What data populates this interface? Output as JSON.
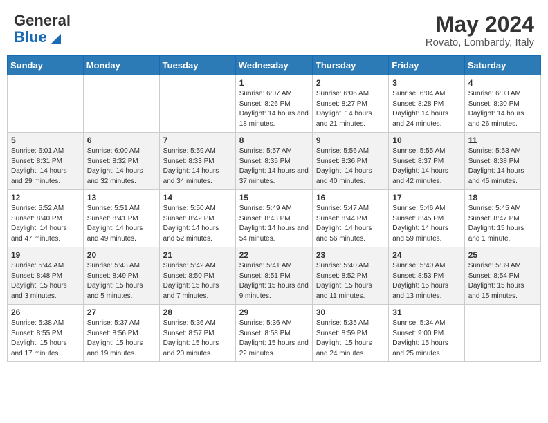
{
  "header": {
    "logo_general": "General",
    "logo_blue": "Blue",
    "month_year": "May 2024",
    "location": "Rovato, Lombardy, Italy"
  },
  "days_of_week": [
    "Sunday",
    "Monday",
    "Tuesday",
    "Wednesday",
    "Thursday",
    "Friday",
    "Saturday"
  ],
  "weeks": [
    {
      "days": [
        {
          "number": "",
          "content": ""
        },
        {
          "number": "",
          "content": ""
        },
        {
          "number": "",
          "content": ""
        },
        {
          "number": "1",
          "content": "Sunrise: 6:07 AM\nSunset: 8:26 PM\nDaylight: 14 hours and 18 minutes."
        },
        {
          "number": "2",
          "content": "Sunrise: 6:06 AM\nSunset: 8:27 PM\nDaylight: 14 hours and 21 minutes."
        },
        {
          "number": "3",
          "content": "Sunrise: 6:04 AM\nSunset: 8:28 PM\nDaylight: 14 hours and 24 minutes."
        },
        {
          "number": "4",
          "content": "Sunrise: 6:03 AM\nSunset: 8:30 PM\nDaylight: 14 hours and 26 minutes."
        }
      ]
    },
    {
      "days": [
        {
          "number": "5",
          "content": "Sunrise: 6:01 AM\nSunset: 8:31 PM\nDaylight: 14 hours and 29 minutes."
        },
        {
          "number": "6",
          "content": "Sunrise: 6:00 AM\nSunset: 8:32 PM\nDaylight: 14 hours and 32 minutes."
        },
        {
          "number": "7",
          "content": "Sunrise: 5:59 AM\nSunset: 8:33 PM\nDaylight: 14 hours and 34 minutes."
        },
        {
          "number": "8",
          "content": "Sunrise: 5:57 AM\nSunset: 8:35 PM\nDaylight: 14 hours and 37 minutes."
        },
        {
          "number": "9",
          "content": "Sunrise: 5:56 AM\nSunset: 8:36 PM\nDaylight: 14 hours and 40 minutes."
        },
        {
          "number": "10",
          "content": "Sunrise: 5:55 AM\nSunset: 8:37 PM\nDaylight: 14 hours and 42 minutes."
        },
        {
          "number": "11",
          "content": "Sunrise: 5:53 AM\nSunset: 8:38 PM\nDaylight: 14 hours and 45 minutes."
        }
      ]
    },
    {
      "days": [
        {
          "number": "12",
          "content": "Sunrise: 5:52 AM\nSunset: 8:40 PM\nDaylight: 14 hours and 47 minutes."
        },
        {
          "number": "13",
          "content": "Sunrise: 5:51 AM\nSunset: 8:41 PM\nDaylight: 14 hours and 49 minutes."
        },
        {
          "number": "14",
          "content": "Sunrise: 5:50 AM\nSunset: 8:42 PM\nDaylight: 14 hours and 52 minutes."
        },
        {
          "number": "15",
          "content": "Sunrise: 5:49 AM\nSunset: 8:43 PM\nDaylight: 14 hours and 54 minutes."
        },
        {
          "number": "16",
          "content": "Sunrise: 5:47 AM\nSunset: 8:44 PM\nDaylight: 14 hours and 56 minutes."
        },
        {
          "number": "17",
          "content": "Sunrise: 5:46 AM\nSunset: 8:45 PM\nDaylight: 14 hours and 59 minutes."
        },
        {
          "number": "18",
          "content": "Sunrise: 5:45 AM\nSunset: 8:47 PM\nDaylight: 15 hours and 1 minute."
        }
      ]
    },
    {
      "days": [
        {
          "number": "19",
          "content": "Sunrise: 5:44 AM\nSunset: 8:48 PM\nDaylight: 15 hours and 3 minutes."
        },
        {
          "number": "20",
          "content": "Sunrise: 5:43 AM\nSunset: 8:49 PM\nDaylight: 15 hours and 5 minutes."
        },
        {
          "number": "21",
          "content": "Sunrise: 5:42 AM\nSunset: 8:50 PM\nDaylight: 15 hours and 7 minutes."
        },
        {
          "number": "22",
          "content": "Sunrise: 5:41 AM\nSunset: 8:51 PM\nDaylight: 15 hours and 9 minutes."
        },
        {
          "number": "23",
          "content": "Sunrise: 5:40 AM\nSunset: 8:52 PM\nDaylight: 15 hours and 11 minutes."
        },
        {
          "number": "24",
          "content": "Sunrise: 5:40 AM\nSunset: 8:53 PM\nDaylight: 15 hours and 13 minutes."
        },
        {
          "number": "25",
          "content": "Sunrise: 5:39 AM\nSunset: 8:54 PM\nDaylight: 15 hours and 15 minutes."
        }
      ]
    },
    {
      "days": [
        {
          "number": "26",
          "content": "Sunrise: 5:38 AM\nSunset: 8:55 PM\nDaylight: 15 hours and 17 minutes."
        },
        {
          "number": "27",
          "content": "Sunrise: 5:37 AM\nSunset: 8:56 PM\nDaylight: 15 hours and 19 minutes."
        },
        {
          "number": "28",
          "content": "Sunrise: 5:36 AM\nSunset: 8:57 PM\nDaylight: 15 hours and 20 minutes."
        },
        {
          "number": "29",
          "content": "Sunrise: 5:36 AM\nSunset: 8:58 PM\nDaylight: 15 hours and 22 minutes."
        },
        {
          "number": "30",
          "content": "Sunrise: 5:35 AM\nSunset: 8:59 PM\nDaylight: 15 hours and 24 minutes."
        },
        {
          "number": "31",
          "content": "Sunrise: 5:34 AM\nSunset: 9:00 PM\nDaylight: 15 hours and 25 minutes."
        },
        {
          "number": "",
          "content": ""
        }
      ]
    }
  ]
}
